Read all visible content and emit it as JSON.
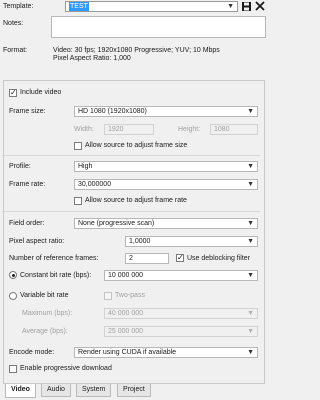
{
  "header": {
    "template_label": "Template:",
    "template_value": "TEST",
    "notes_label": "Notes:",
    "format_label": "Format:",
    "format_line1": "Video: 30 fps; 1920x1080 Progressive; YUV; 10 Mbps",
    "format_line2": "Pixel Aspect Ratio: 1,000"
  },
  "video": {
    "include_video_label": "Include video",
    "include_video_checked": true,
    "frame_size_label": "Frame size:",
    "frame_size_value": "HD 1080 (1920x1080)",
    "width_label": "Width:",
    "width_value": "1920",
    "height_label": "Height:",
    "height_value": "1080",
    "allow_frame_size_label": "Allow source to adjust frame size",
    "allow_frame_size_checked": false,
    "profile_label": "Profile:",
    "profile_value": "High",
    "frame_rate_label": "Frame rate:",
    "frame_rate_value": "30,000000",
    "allow_frame_rate_label": "Allow source to adjust frame rate",
    "allow_frame_rate_checked": false,
    "field_order_label": "Field order:",
    "field_order_value": "None (progressive scan)",
    "par_label": "Pixel aspect ratio:",
    "par_value": "1,0000",
    "ref_frames_label": "Number of reference frames:",
    "ref_frames_value": "2",
    "deblocking_label": "Use deblocking filter",
    "deblocking_checked": true,
    "cbr_label": "Constant bit rate (bps):",
    "cbr_value": "10 000 000",
    "cbr_selected": true,
    "vbr_label": "Variable bit rate",
    "two_pass_label": "Two-pass",
    "maximum_label": "Maximum (bps):",
    "maximum_value": "40 000 000",
    "average_label": "Average (bps):",
    "average_value": "25 000 000",
    "encode_mode_label": "Encode mode:",
    "encode_mode_value": "Render using CUDA if available",
    "progressive_download_label": "Enable progressive download",
    "progressive_download_checked": false
  },
  "tabs": [
    "Video",
    "Audio",
    "System",
    "Project"
  ],
  "icons": {
    "save": "save-icon",
    "delete": "delete-icon",
    "dropdown": "chevron-down-icon"
  },
  "colors": {
    "selection": "#3399ff",
    "background": "#f0f0f0"
  }
}
